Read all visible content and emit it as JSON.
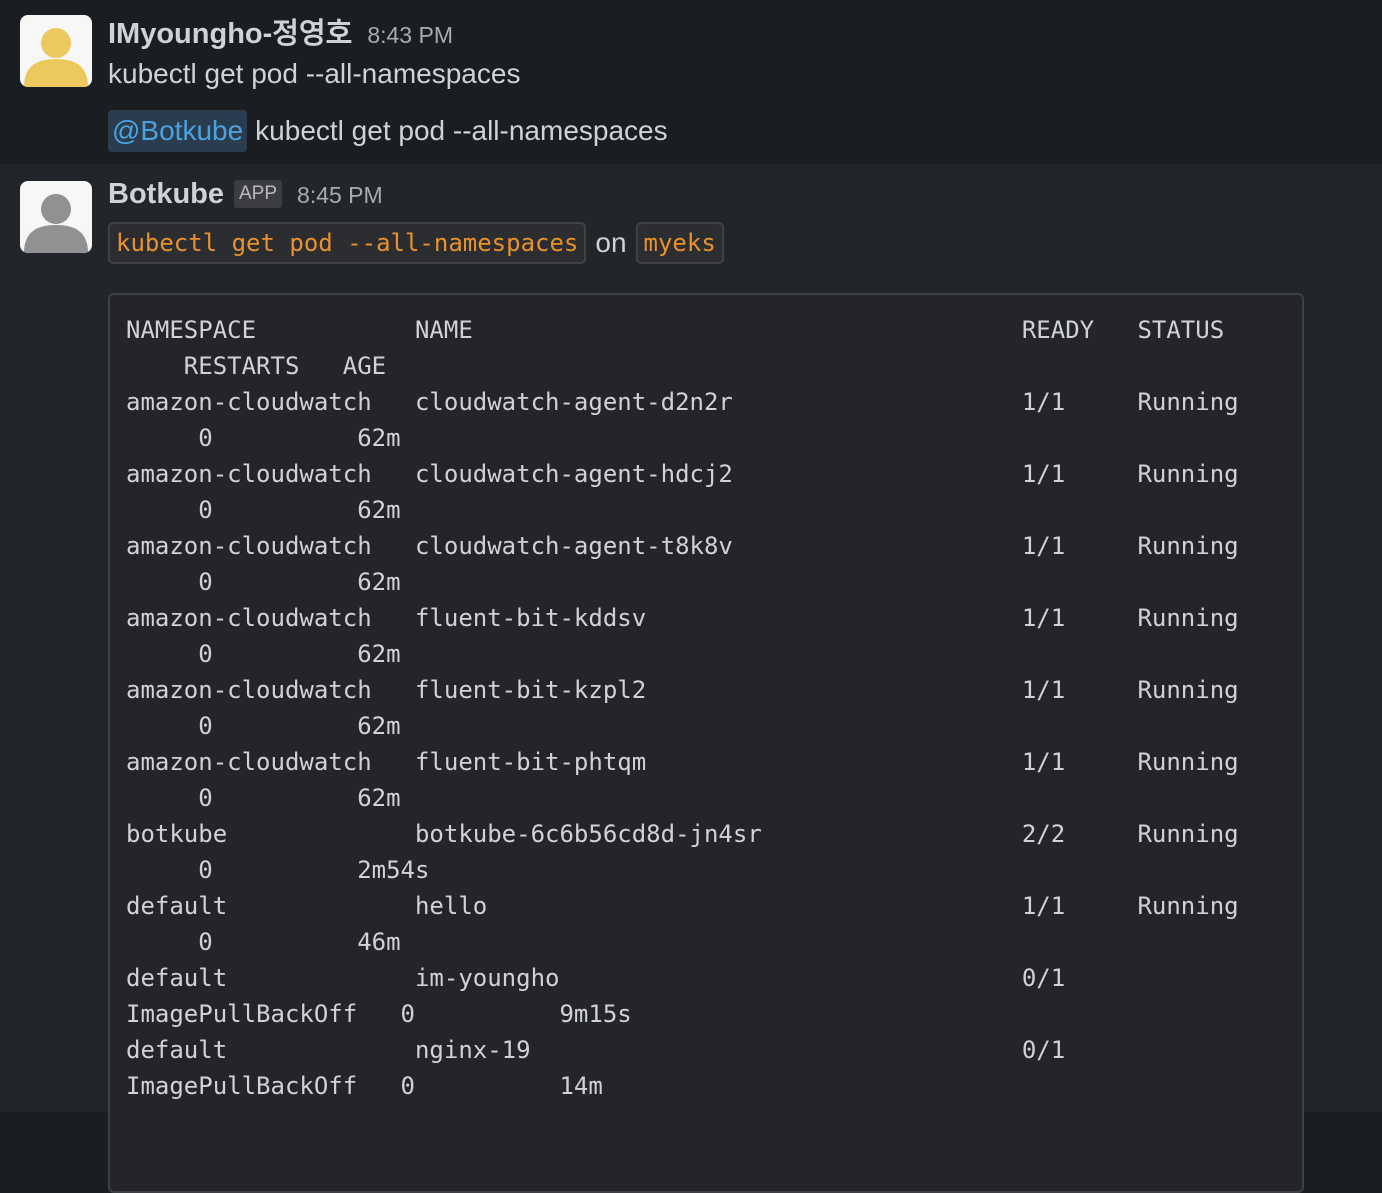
{
  "messages": [
    {
      "sender": "IMyoungho-정영호",
      "time": "8:43 PM",
      "lines": [
        "kubectl get pod  --all-namespaces"
      ],
      "mention": "@Botkube",
      "mention_text": "kubectl get pod --all-namespaces"
    },
    {
      "sender": "Botkube",
      "badge": "APP",
      "time": "8:45 PM",
      "command": "kubectl get pod --all-namespaces",
      "on_word": "on",
      "cluster": "myeks"
    }
  ],
  "output": {
    "lines": [
      "NAMESPACE           NAME                                      READY   STATUS",
      "    RESTARTS   AGE",
      "amazon-cloudwatch   cloudwatch-agent-d2n2r                    1/1     Running",
      "     0          62m",
      "amazon-cloudwatch   cloudwatch-agent-hdcj2                    1/1     Running",
      "     0          62m",
      "amazon-cloudwatch   cloudwatch-agent-t8k8v                    1/1     Running",
      "     0          62m",
      "amazon-cloudwatch   fluent-bit-kddsv                          1/1     Running",
      "     0          62m",
      "amazon-cloudwatch   fluent-bit-kzpl2                          1/1     Running",
      "     0          62m",
      "amazon-cloudwatch   fluent-bit-phtqm                          1/1     Running",
      "     0          62m",
      "botkube             botkube-6c6b56cd8d-jn4sr                  2/2     Running",
      "     0          2m54s",
      "default             hello                                     1/1     Running",
      "     0          46m",
      "default             im-youngho                                0/1",
      "ImagePullBackOff   0          9m15s",
      "default             nginx-19                                  0/1",
      "ImagePullBackOff   0          14m"
    ]
  }
}
